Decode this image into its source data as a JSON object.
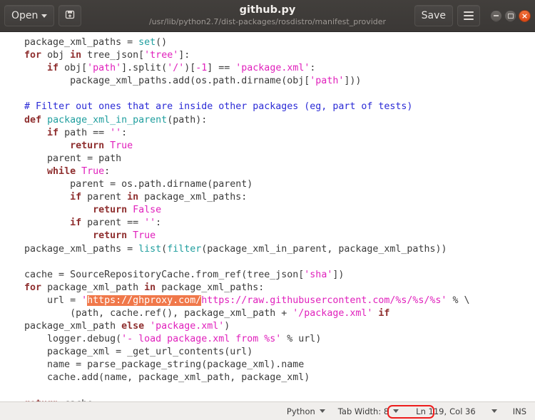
{
  "titlebar": {
    "open_label": "Open",
    "open_caret_icon": "chevron-down-icon",
    "newdoc_icon": "new-document-icon",
    "title": "github.py",
    "subtitle": "/usr/lib/python2.7/dist-packages/rosdistro/manifest_provider",
    "save_label": "Save",
    "menu_icon": "hamburger-menu-icon",
    "minimize_icon": "minimize-icon",
    "maximize_icon": "maximize-icon",
    "close_icon": "close-icon",
    "close_glyph": "×"
  },
  "editor": {
    "selection_text": "https://ghproxy.com/",
    "selection_color": "#f0784a",
    "lines": [
      "package_xml_paths = set()",
      "for obj in tree_json['tree']:",
      "    if obj['path'].split('/')[-1] == 'package.xml':",
      "        package_xml_paths.add(os.path.dirname(obj['path']))",
      "",
      "# Filter out ones that are inside other packages (eg, part of tests)",
      "def package_xml_in_parent(path):",
      "    if path == '':",
      "        return True",
      "    parent = path",
      "    while True:",
      "        parent = os.path.dirname(parent)",
      "        if parent in package_xml_paths:",
      "            return False",
      "        if parent == '':",
      "            return True",
      "package_xml_paths = list(filter(package_xml_in_parent, package_xml_paths))",
      "",
      "cache = SourceRepositoryCache.from_ref(tree_json['sha'])",
      "for package_xml_path in package_xml_paths:",
      "    url = 'https://ghproxy.com/https://raw.githubusercontent.com/%s/%s/%s' % \\",
      "        (path, cache.ref(), package_xml_path + '/package.xml' if",
      "package_xml_path else 'package.xml')",
      "    logger.debug('- load package.xml from %s' % url)",
      "    package_xml = _get_url_contents(url)",
      "    name = parse_package_string(package_xml).name",
      "    cache.add(name, package_xml_path, package_xml)",
      "",
      "    return cache"
    ]
  },
  "statusbar": {
    "language": "Python",
    "language_caret_icon": "chevron-down-icon",
    "tab_width": "Tab Width: 8",
    "tab_width_caret_icon": "chevron-down-icon",
    "position_ln": "Ln 119,",
    "position_col": "Col 36",
    "position_caret_icon": "chevron-down-icon",
    "insert_mode": "INS"
  },
  "annotation": {
    "color": "#ee1c1c",
    "label": "ln-119-highlight-box"
  }
}
